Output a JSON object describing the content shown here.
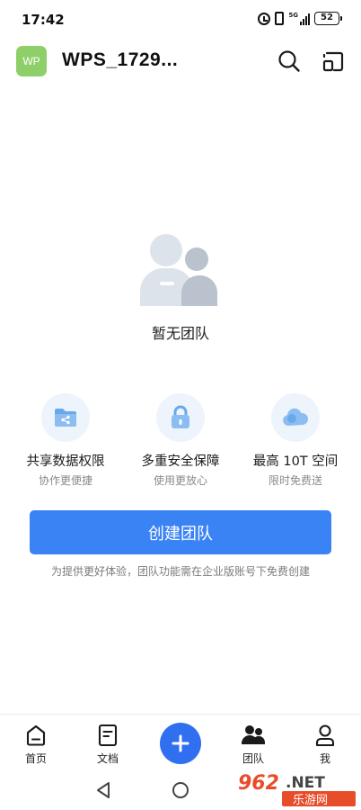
{
  "status_bar": {
    "time": "17:42",
    "network": "5G",
    "battery": "52"
  },
  "header": {
    "logo_text": "WP",
    "title": "WPS_1729...",
    "icons": [
      "search-icon",
      "switch-icon"
    ]
  },
  "empty_state": {
    "text": "暂无团队"
  },
  "features": [
    {
      "icon": "share-folder-icon",
      "title": "共享数据权限",
      "subtitle": "协作更便捷"
    },
    {
      "icon": "lock-icon",
      "title": "多重安全保障",
      "subtitle": "使用更放心"
    },
    {
      "icon": "cloud-icon",
      "title": "最高 10T 空间",
      "subtitle": "限时免费送"
    }
  ],
  "create_button": {
    "label": "创建团队",
    "color": "#3a83f5"
  },
  "notice": "为提供更好体验，团队功能需在企业版账号下免费创建",
  "tabbar": {
    "tabs": [
      {
        "label": "首页",
        "icon": "home-icon"
      },
      {
        "label": "文档",
        "icon": "document-icon"
      },
      {
        "label": "",
        "icon": "plus-icon"
      },
      {
        "label": "团队",
        "icon": "team-icon"
      },
      {
        "label": "我",
        "icon": "person-icon"
      }
    ],
    "fab_color": "#2f6ff0"
  },
  "watermark": {
    "top_text": "962.NET",
    "bottom_text": "乐游网"
  }
}
